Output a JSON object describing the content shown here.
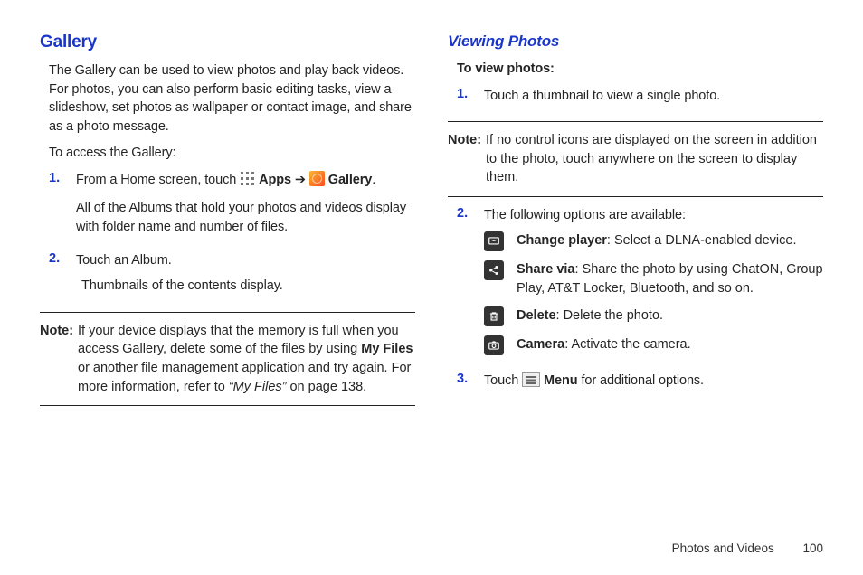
{
  "left": {
    "heading": "Gallery",
    "intro": "The Gallery can be used to view photos and play back videos. For photos, you can also perform basic editing tasks, view a slideshow, set photos as wallpaper or contact image, and share as a photo message.",
    "access_intro": "To access the Gallery:",
    "steps": [
      {
        "num": "1.",
        "pre": "From a Home screen, touch ",
        "apps_label": " Apps",
        "arrow": " ➔ ",
        "gallery_label": " Gallery",
        "post": ".",
        "after": "All of the Albums that hold your photos and videos display with folder name and number of files."
      },
      {
        "num": "2.",
        "line": "Touch an Album.",
        "after": "Thumbnails of the contents display."
      }
    ],
    "note_label": "Note:",
    "note_pre": "If your device displays that the memory is full when you access Gallery, delete some of the files by using ",
    "note_bold": "My Files",
    "note_mid": " or another file management application and try again. For more information, refer to ",
    "note_italic": "“My Files”",
    "note_post": " on page 138."
  },
  "right": {
    "heading": "Viewing Photos",
    "sub": "To view photos:",
    "step1_num": "1.",
    "step1": "Touch a thumbnail to view a single photo.",
    "note_label": "Note:",
    "note": "If no control icons are displayed on the screen in addition to the photo, touch anywhere on the screen to display them.",
    "step2_num": "2.",
    "step2_intro": "The following options are available:",
    "options": [
      {
        "bold": "Change player",
        "rest": ": Select a DLNA-enabled device."
      },
      {
        "bold": "Share via",
        "rest": ": Share the photo by using ChatON, Group Play, AT&T Locker, Bluetooth, and so on."
      },
      {
        "bold": "Delete",
        "rest": ": Delete the photo."
      },
      {
        "bold": "Camera",
        "rest": ": Activate the camera."
      }
    ],
    "step3_num": "3.",
    "step3_pre": "Touch ",
    "step3_bold": " Menu",
    "step3_post": " for additional options."
  },
  "footer": {
    "section": "Photos and Videos",
    "page": "100"
  }
}
